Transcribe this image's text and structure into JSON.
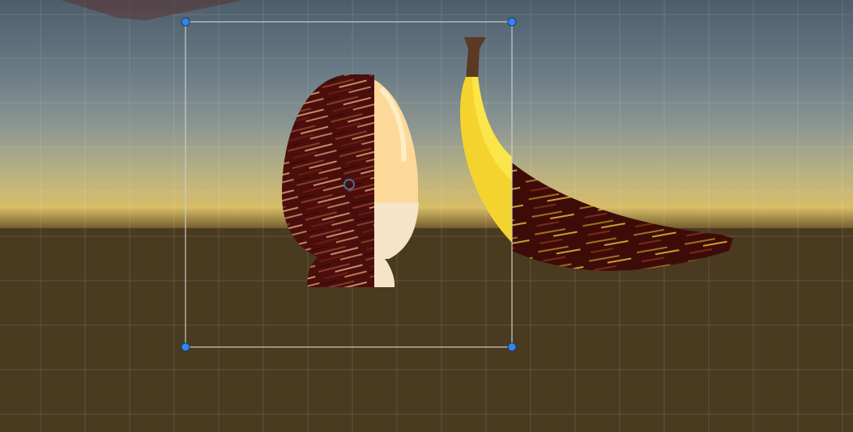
{
  "scene_view": {
    "tool": "rect-transform",
    "objects": [
      "egg-sprite",
      "banana-sprite"
    ],
    "colors": {
      "sky_top": "#4e5d6b",
      "sky_mid": "#7e8c8f",
      "horizon": "#d4bb6a",
      "ground": "#4a3a20",
      "handle": "#2f86ee",
      "selection": "#c8ccd0",
      "banana": "#f5d32e",
      "egg_cream": "#f6e4c8",
      "egg_yellow": "#fcd999",
      "texture": "#4a0f0c"
    }
  }
}
